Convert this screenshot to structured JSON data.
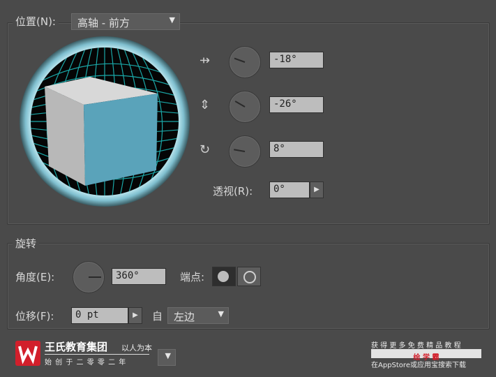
{
  "position": {
    "label": "位置(N):",
    "preset_value": "高轴 - 前方",
    "rotation": [
      {
        "icon": "rotate-x-icon",
        "glyph": "⇸",
        "value": "-18°",
        "knob_angle": 200
      },
      {
        "icon": "rotate-y-icon",
        "glyph": "⇕",
        "value": "-26°",
        "knob_angle": 210
      },
      {
        "icon": "rotate-z-icon",
        "glyph": "↻",
        "value": "8°",
        "knob_angle": 190
      }
    ],
    "perspective_label": "透视(R):",
    "perspective_value": "0°"
  },
  "revolve": {
    "label": "旋转",
    "angle_label": "角度(E):",
    "angle_value": "360°",
    "cap_label": "端点:",
    "offset_label": "位移(F):",
    "offset_value": "0 pt",
    "from_label": "自",
    "from_value": "左边"
  },
  "watermark": {
    "brand": "王氏教育集团",
    "slogan": "以人为本",
    "sub": "始 创 于 二 零 零 二 年",
    "promo_line1": "获 得 更 多 免 费 精 品 教 程",
    "promo_app": "绘 学 霸",
    "promo_line3": "在AppStore或应用宝搜索下载"
  },
  "colors": {
    "cube_front": "#5aa3ba",
    "cube_side": "#bdbdbd",
    "grid": "#1aa7a7",
    "ring": "#8fd0df"
  }
}
